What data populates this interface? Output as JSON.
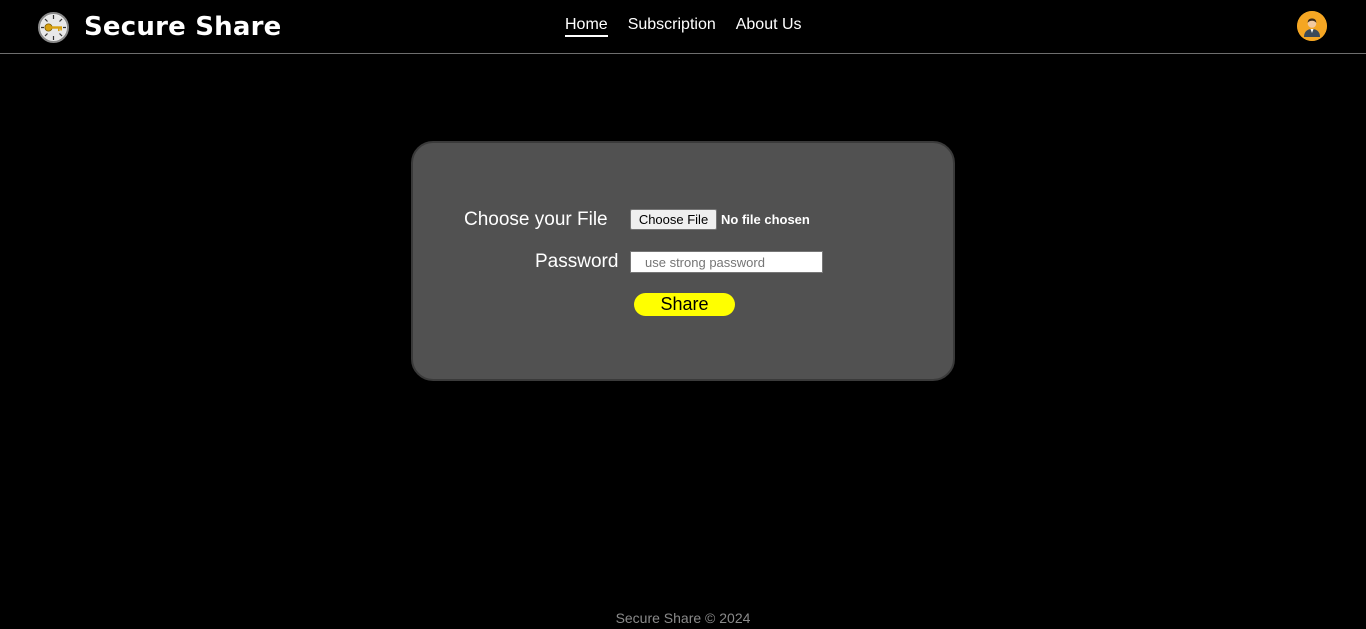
{
  "brand": {
    "name": "Secure Share",
    "logo_icon": "key-logo-icon"
  },
  "nav": {
    "items": [
      {
        "label": "Home",
        "active": true
      },
      {
        "label": "Subscription",
        "active": false
      },
      {
        "label": "About Us",
        "active": false
      }
    ]
  },
  "user": {
    "avatar_icon": "user-avatar-icon"
  },
  "form": {
    "file_label": "Choose your File",
    "file_button": "Choose File",
    "file_status": "No file chosen",
    "password_label": "Password",
    "password_placeholder": "use strong password",
    "password_value": "",
    "share_button": "Share"
  },
  "footer": {
    "text": "Secure Share © 2024"
  },
  "colors": {
    "background": "#000000",
    "card": "#515151",
    "accent": "#ffff00",
    "avatar": "#f5a623"
  }
}
